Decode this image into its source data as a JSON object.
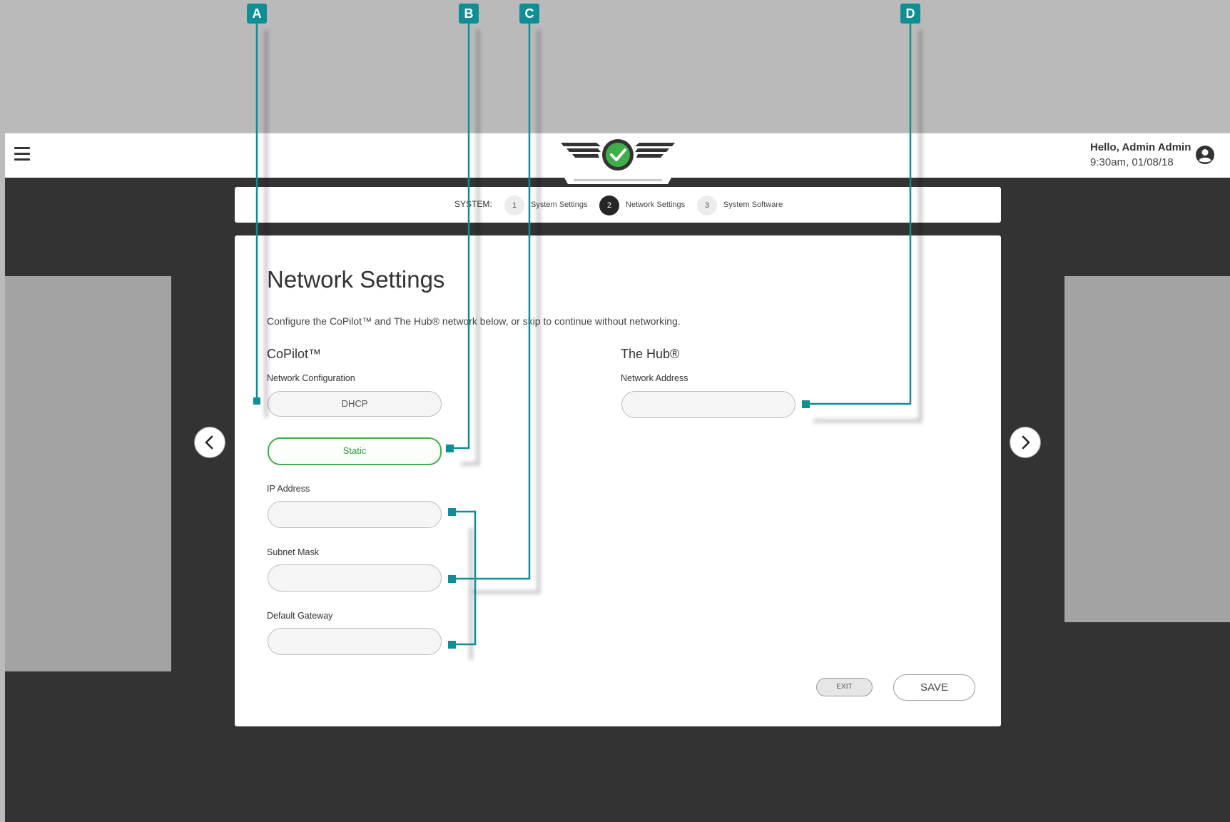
{
  "header": {
    "greeting": "Hello, Admin Admin",
    "datetime": "9:30am, 01/08/18"
  },
  "stepper": {
    "prefix": "SYSTEM:",
    "steps": [
      {
        "number": "1",
        "label": "System Settings",
        "active": false
      },
      {
        "number": "2",
        "label": "Network Settings",
        "active": true
      },
      {
        "number": "3",
        "label": "System Software",
        "active": false
      }
    ]
  },
  "page": {
    "title": "Network Settings",
    "description": "Configure the CoPilot™ and The Hub® network below, or skip to continue without networking."
  },
  "copilot": {
    "title": "CoPilot™",
    "network_config_label": "Network Configuration",
    "options": [
      {
        "label": "DHCP",
        "selected": false
      },
      {
        "label": "Static",
        "selected": true
      }
    ],
    "ip_label": "IP Address",
    "ip_value": "",
    "subnet_label": "Subnet Mask",
    "subnet_value": "",
    "gateway_label": "Default Gateway",
    "gateway_value": ""
  },
  "hub": {
    "title": "The Hub®",
    "address_label": "Network Address",
    "address_value": ""
  },
  "actions": {
    "exit_label": "EXIT",
    "save_label": "SAVE"
  },
  "annotations": [
    "A",
    "B",
    "C",
    "D"
  ],
  "colors": {
    "accent_teal": "#0f8e94",
    "selected_green": "#3fae49",
    "app_background": "#333333",
    "outer_background": "#bababa",
    "step_active": "#262626"
  },
  "icons": {
    "menu": "hamburger-menu-icon",
    "user": "user-account-icon",
    "prev": "chevron-left-icon",
    "next": "chevron-right-icon",
    "logo": "winged-check-logo"
  }
}
